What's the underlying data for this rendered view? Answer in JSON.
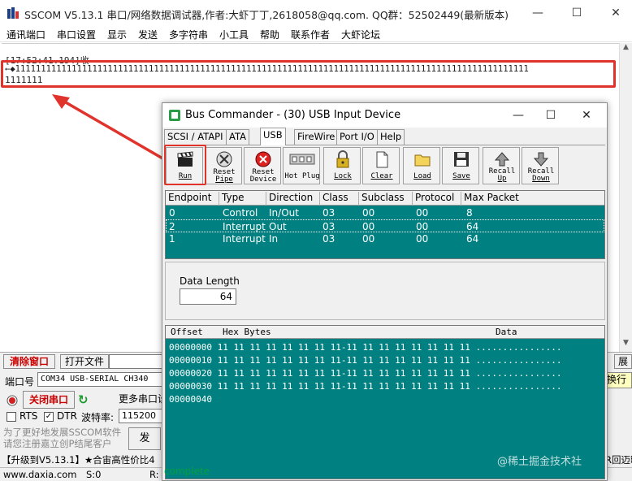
{
  "sscom": {
    "title": "SSCOM V5.13.1 串口/网络数据调试器,作者:大虾丁丁,2618058@qq.com. QQ群：52502449(最新版本)",
    "menu": [
      "通讯端口",
      "串口设置",
      "显示",
      "发送",
      "多字符串",
      "小工具",
      "帮助",
      "联系作者",
      "大虾论坛"
    ],
    "recv": {
      "line1": "[17:52:41.194]收",
      "line2": "←◆1111111111111111111111111111111111111111111111111111111111111111111111111111111111111111111111111111",
      "line3": "1111111"
    },
    "bottom": {
      "clear_window": "清除窗口",
      "open_file": "打开文件",
      "port_label": "端口号",
      "port_value": "COM34 USB-SERIAL CH340",
      "close_port": "关闭串口",
      "more_ports": "更多串口设",
      "rts_label": "RTS",
      "dtr_label": "DTR",
      "baud_label": "波特率:",
      "baud_value": "115200",
      "promo_line1": "为了更好地发展SSCOM软件",
      "promo_line2": "请您注册嘉立创P结尾客户",
      "send_btn": "发",
      "right_btn1": "展",
      "right_btn2": "换行",
      "news": "【升级到V5.13.1】★合宙高性价比4",
      "news_right": "R回迈略",
      "status_site": "www.daxia.com",
      "status_s": "S:0",
      "status_r": "R:"
    }
  },
  "bus_commander": {
    "title": "Bus Commander - (30) USB Input Device",
    "tabs": [
      "SCSI / ATAPI",
      "ATA",
      "USB",
      "FireWire",
      "Port I/O",
      "Help"
    ],
    "active_tab": "USB",
    "toolbar": [
      {
        "icon": "clapperboard-icon",
        "line1": "Run",
        "line2": ""
      },
      {
        "icon": "reset-pipe-icon",
        "line1": "Reset",
        "line2": "Pipe"
      },
      {
        "icon": "reset-device-icon",
        "line1": "Reset",
        "line2": "Device"
      },
      {
        "icon": "hot-plug-icon",
        "line1": "Hot Plug",
        "line2": ""
      },
      {
        "icon": "lock-icon",
        "line1": "Lock",
        "line2": ""
      },
      {
        "icon": "clear-page-icon",
        "line1": "Clear",
        "line2": ""
      },
      {
        "icon": "folder-icon",
        "line1": "Load",
        "line2": ""
      },
      {
        "icon": "floppy-save-icon",
        "line1": "Save",
        "line2": ""
      },
      {
        "icon": "recall-up-icon",
        "line1": "Recall",
        "line2": "Up"
      },
      {
        "icon": "recall-down-icon",
        "line1": "Recall",
        "line2": "Down"
      }
    ],
    "endpoints": {
      "columns": [
        "Endpoint",
        "Type",
        "Direction",
        "Class",
        "Subclass",
        "Protocol",
        "Max Packet"
      ],
      "rows": [
        [
          "0",
          "Control",
          "In/Out",
          "03",
          "00",
          "00",
          "8"
        ],
        [
          "2",
          "Interrupt",
          "Out",
          "03",
          "00",
          "00",
          "64"
        ],
        [
          "1",
          "Interrupt",
          "In",
          "03",
          "00",
          "00",
          "64"
        ]
      ]
    },
    "data_length": {
      "label": "Data Length",
      "value": "64"
    },
    "hex": {
      "columns": [
        "Offset",
        "Hex Bytes",
        "Data"
      ],
      "rows": [
        "00000000 11 11 11 11 11 11 11 11-11 11 11 11 11 11 11 11 ................",
        "00000010 11 11 11 11 11 11 11 11-11 11 11 11 11 11 11 11 ................",
        "00000020 11 11 11 11 11 11 11 11-11 11 11 11 11 11 11 11 ................",
        "00000030 11 11 11 11 11 11 11 11-11 11 11 11 11 11 11 11 ................",
        "00000040"
      ],
      "status": "complete"
    },
    "watermark": "@稀土掘金技术社"
  },
  "colors": {
    "annotation_red": "#e0332b",
    "teal": "#008080",
    "status_green": "#00a040"
  }
}
